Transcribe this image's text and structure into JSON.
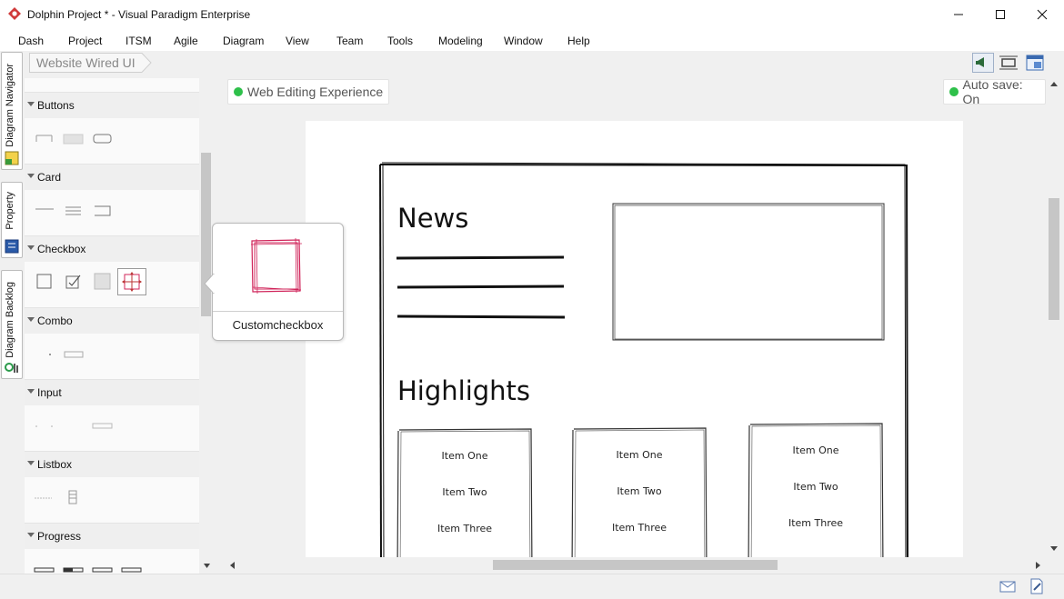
{
  "window": {
    "title": "Dolphin Project * - Visual Paradigm Enterprise",
    "minimize": "—",
    "maximize": "☐",
    "close": "✕"
  },
  "menu": [
    "Dash",
    "Project",
    "ITSM",
    "Agile",
    "Diagram",
    "View",
    "Team",
    "Tools",
    "Modeling",
    "Window",
    "Help"
  ],
  "side_tabs": {
    "navigator": "Diagram Navigator",
    "property": "Property",
    "backlog": "Diagram Backlog"
  },
  "breadcrumb": "Website Wired UI",
  "palette": {
    "categories": [
      "Buttons",
      "Card",
      "Checkbox",
      "Combo",
      "Input",
      "Listbox",
      "Progress"
    ]
  },
  "tooltip": {
    "label": "Customcheckbox"
  },
  "canvas": {
    "experience_chip": "Web Editing Experience",
    "autosave_chip": "Auto save: On",
    "status_color": "#2ec04a",
    "wireframe": {
      "news_title": "News",
      "highlights_title": "Highlights",
      "cards": [
        {
          "items": [
            "Item One",
            "Item Two",
            "Item Three"
          ]
        },
        {
          "items": [
            "Item One",
            "Item Two",
            "Item Three"
          ]
        },
        {
          "items": [
            "Item One",
            "Item Two",
            "Item Three"
          ]
        }
      ]
    }
  },
  "accent_color": "#d0245a"
}
